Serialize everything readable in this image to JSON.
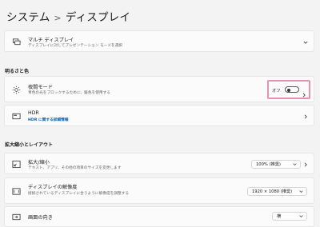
{
  "header": {
    "parent": "システム",
    "separator": ">",
    "current": "ディスプレイ"
  },
  "cards": {
    "multi_display": {
      "label": "マルチ ディスプレイ",
      "desc": "ディスプレイに対してプレゼンテーション モードを選択"
    },
    "night_light": {
      "label": "夜間モード",
      "desc": "青色の光をブロックするために、暖色を使用する",
      "toggle_state": "オフ",
      "toggle_on": false
    },
    "hdr": {
      "label": "HDR",
      "link": "HDR に関する詳細情報"
    },
    "scale": {
      "label": "拡大/縮小",
      "desc": "テキスト、アプリ、その他の項目のサイズを変更します",
      "value": "100% (推奨)"
    },
    "resolution": {
      "label": "ディスプレイの解像度",
      "desc": "接続されているディスプレイに合うように解像度を調整する",
      "value": "1920 × 1080 (推奨)"
    },
    "orientation": {
      "label": "画面の向き",
      "value": "横"
    }
  },
  "sections": {
    "brightness_color": "明るさと色",
    "scale_layout": "拡大縮小とレイアウト"
  },
  "colors": {
    "highlight": "#ec8fb4",
    "link": "#0b5cad"
  }
}
